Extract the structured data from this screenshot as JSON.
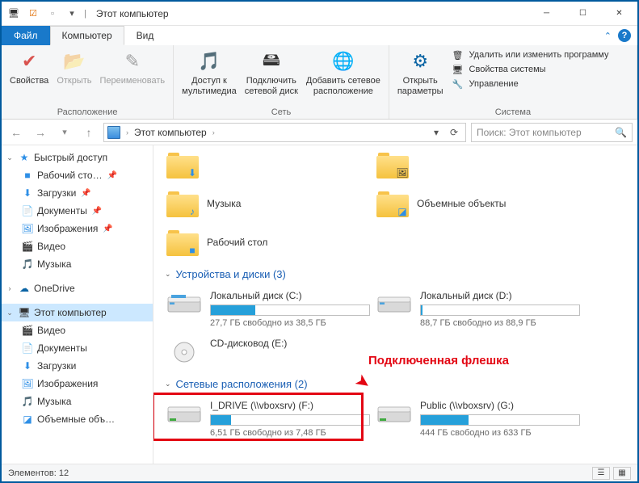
{
  "title": "Этот компьютер",
  "tabs": {
    "file": "Файл",
    "computer": "Компьютер",
    "view": "Вид"
  },
  "ribbon": {
    "location": {
      "label": "Расположение",
      "props": "Свойства",
      "open": "Открыть",
      "rename": "Переименовать"
    },
    "network": {
      "label": "Сеть",
      "media": "Доступ к\nмультимедиа",
      "mapdrive": "Подключить\nсетевой диск",
      "addloc": "Добавить сетевое\nрасположение"
    },
    "system": {
      "label": "Система",
      "openparams": "Открыть\nпараметры",
      "uninstall": "Удалить или изменить программу",
      "sysprops": "Свойства системы",
      "manage": "Управление"
    }
  },
  "address": {
    "root": "Этот компьютер"
  },
  "search": {
    "placeholder": "Поиск: Этот компьютер"
  },
  "sidebar": {
    "quick": "Быстрый доступ",
    "desktop": "Рабочий сто…",
    "downloads": "Загрузки",
    "documents": "Документы",
    "pictures": "Изображения",
    "videos": "Видео",
    "music": "Музыка",
    "onedrive": "OneDrive",
    "thispc": "Этот компьютер",
    "s_videos": "Видео",
    "s_documents": "Документы",
    "s_downloads": "Загрузки",
    "s_pictures": "Изображения",
    "s_music": "Музыка",
    "s_3d": "Объемные объ…"
  },
  "folders": {
    "music": "Музыка",
    "objects3d": "Объемные объекты",
    "desktop": "Рабочий стол"
  },
  "sections": {
    "drives": "Устройства и диски (3)",
    "network": "Сетевые расположения (2)"
  },
  "drives": {
    "c": {
      "name": "Локальный диск (C:)",
      "info": "27,7 ГБ свободно из 38,5 ГБ",
      "fill": 28
    },
    "d": {
      "name": "Локальный диск (D:)",
      "info": "88,7 ГБ свободно из 88,9 ГБ",
      "fill": 1
    },
    "e": {
      "name": "CD-дисковод (E:)"
    }
  },
  "netloc": {
    "f": {
      "name": "I_DRIVE (\\\\vboxsrv) (F:)",
      "info": "6,51 ГБ свободно из 7,48 ГБ",
      "fill": 13
    },
    "g": {
      "name": "Public (\\\\vboxsrv) (G:)",
      "info": "444 ГБ свободно из 633 ГБ",
      "fill": 30
    }
  },
  "annotation": "Подключенная флешка",
  "status": {
    "count": "Элементов: 12"
  }
}
